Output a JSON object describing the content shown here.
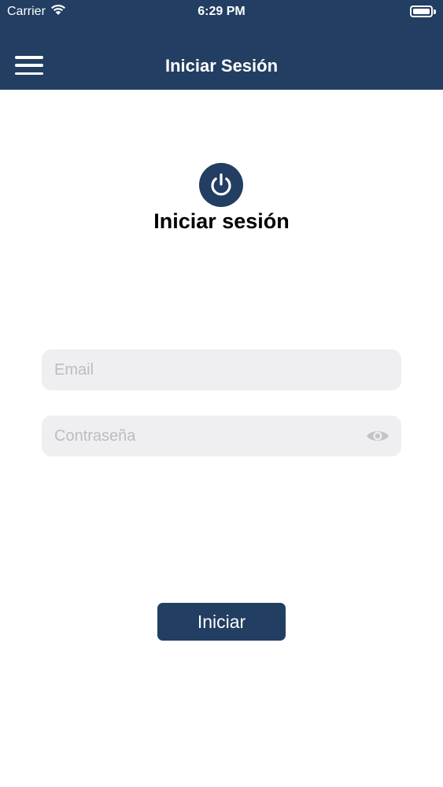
{
  "status_bar": {
    "carrier": "Carrier",
    "time": "6:29 PM",
    "icons": [
      "wifi-icon",
      "battery-icon"
    ]
  },
  "nav": {
    "title": "Iniciar Sesión",
    "menu_icon": "hamburger-menu-icon"
  },
  "login": {
    "logo_icon": "power-icon",
    "heading": "Iniciar sesión",
    "email": {
      "placeholder": "Email",
      "value": ""
    },
    "password": {
      "placeholder": "Contraseña",
      "value": "",
      "toggle_icon": "eye-icon"
    },
    "submit_label": "Iniciar"
  },
  "colors": {
    "primary": "#223e62",
    "input_background": "#efeef1",
    "placeholder": "#bdbcc1",
    "background": "#ffffff"
  }
}
